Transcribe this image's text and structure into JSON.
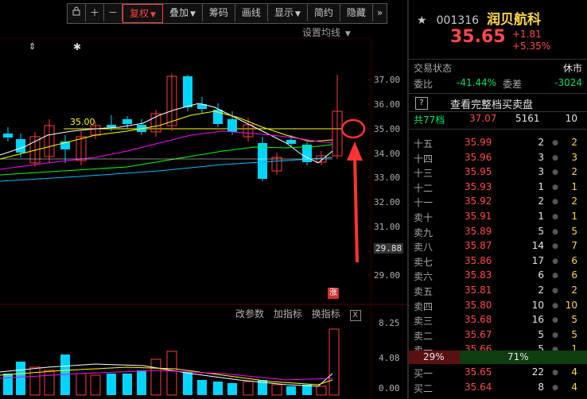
{
  "toolbar": {
    "buttons": [
      "复权",
      "叠加",
      "筹码",
      "画线",
      "显示",
      "简约",
      "隐藏"
    ]
  },
  "chart": {
    "ma_settings": "设置均线",
    "price_ref_label": "35.00",
    "y_labels": [
      "37.00",
      "36.00",
      "35.00",
      "34.00",
      "33.00",
      "32.00",
      "31.00",
      "30.00",
      "29.00"
    ],
    "y_current": "29.88",
    "limit_badge": "涨",
    "indicator_buttons": [
      "改参数",
      "加指标",
      "换指标"
    ],
    "indicator_close": "X",
    "vol_labels": [
      "8.25",
      "4.08",
      "0.00"
    ],
    "colors": {
      "up": "#ff3b3b",
      "down": "#00d4ff",
      "ma5": "#ffffff",
      "ma10": "#ffff00",
      "ma20": "#ff00ff",
      "ma30": "#00ff00"
    }
  },
  "quote": {
    "code": "001316",
    "name": "润贝航科",
    "price": "35.65",
    "change": "+1.81",
    "change_pct": "+5.35%",
    "status_label": "交易状态",
    "status_value": "休市",
    "weibi_label": "委比",
    "weibi_value": "-41.44%",
    "weicha_label": "委差",
    "weicha_value": "-3024",
    "full_orderbook": "查看完整档买卖盘",
    "levels_label": "共77档",
    "levels_price": "37.07",
    "levels_vol": "5161",
    "levels_count": "10",
    "sell_rows": [
      {
        "label": "十五",
        "price": "35.99",
        "vol": "2",
        "cnt": "2"
      },
      {
        "label": "十四",
        "price": "35.96",
        "vol": "3",
        "cnt": "3"
      },
      {
        "label": "十三",
        "price": "35.95",
        "vol": "3",
        "cnt": "2"
      },
      {
        "label": "十二",
        "price": "35.93",
        "vol": "1",
        "cnt": "1"
      },
      {
        "label": "十一",
        "price": "35.92",
        "vol": "2",
        "cnt": "2"
      },
      {
        "label": "卖十",
        "price": "35.91",
        "vol": "1",
        "cnt": "1"
      },
      {
        "label": "卖九",
        "price": "35.89",
        "vol": "5",
        "cnt": "5"
      },
      {
        "label": "卖八",
        "price": "35.87",
        "vol": "14",
        "cnt": "7"
      },
      {
        "label": "卖七",
        "price": "35.86",
        "vol": "17",
        "cnt": "6"
      },
      {
        "label": "卖六",
        "price": "35.83",
        "vol": "6",
        "cnt": "6"
      },
      {
        "label": "卖五",
        "price": "35.81",
        "vol": "2",
        "cnt": "2"
      },
      {
        "label": "卖四",
        "price": "35.80",
        "vol": "10",
        "cnt": "10"
      },
      {
        "label": "卖三",
        "price": "35.68",
        "vol": "16",
        "cnt": "5"
      },
      {
        "label": "卖二",
        "price": "35.67",
        "vol": "5",
        "cnt": "5"
      },
      {
        "label": "卖一",
        "price": "35.66",
        "vol": "5",
        "cnt": "1"
      }
    ],
    "ratio_left": "29%",
    "ratio_right": "71%",
    "buy_rows": [
      {
        "label": "买一",
        "price": "35.65",
        "vol": "22",
        "cnt": "4"
      },
      {
        "label": "买二",
        "price": "35.64",
        "vol": "8",
        "cnt": "4"
      }
    ]
  }
}
